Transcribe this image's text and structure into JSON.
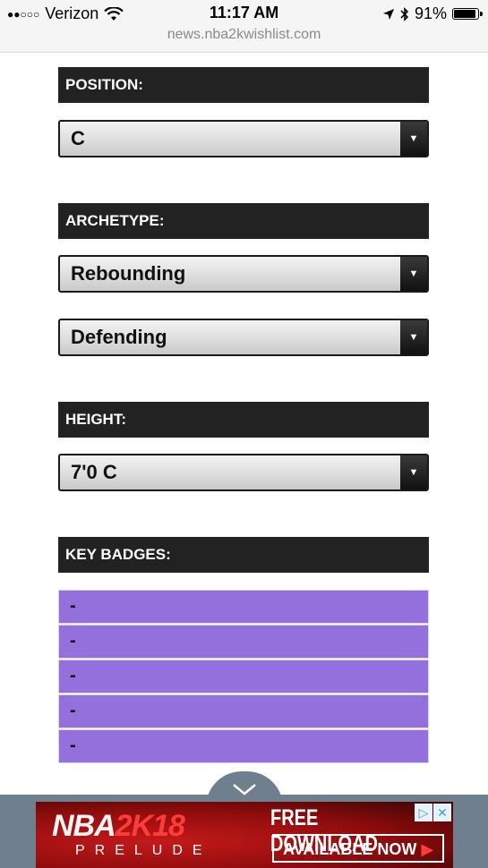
{
  "status_bar": {
    "signal": "●●○○○",
    "carrier": "Verizon",
    "time": "11:17 AM",
    "battery": "91%",
    "battery_level": 0.91,
    "url": "news.nba2kwishlist.com"
  },
  "form": {
    "position": {
      "label": "POSITION:",
      "value": "C"
    },
    "archetype": {
      "label": "ARCHETYPE:",
      "primary": "Rebounding",
      "secondary": "Defending"
    },
    "height": {
      "label": "HEIGHT:",
      "value": "7'0 C"
    },
    "key_badges": {
      "label": "KEY BADGES:",
      "items": [
        "-",
        "-",
        "-",
        "-",
        "-"
      ]
    }
  },
  "ad": {
    "logo_prefix": "NBA",
    "logo_accent": "2K18",
    "subtitle": "PRELUDE",
    "headline": "FREE DOWNLOAD",
    "cta": "AVAILABLE NOW",
    "cta_arrow": "▶"
  },
  "colors": {
    "header_bg": "#222222",
    "badge_bg": "#9370db",
    "ad_bar": "#6f7f8d"
  }
}
